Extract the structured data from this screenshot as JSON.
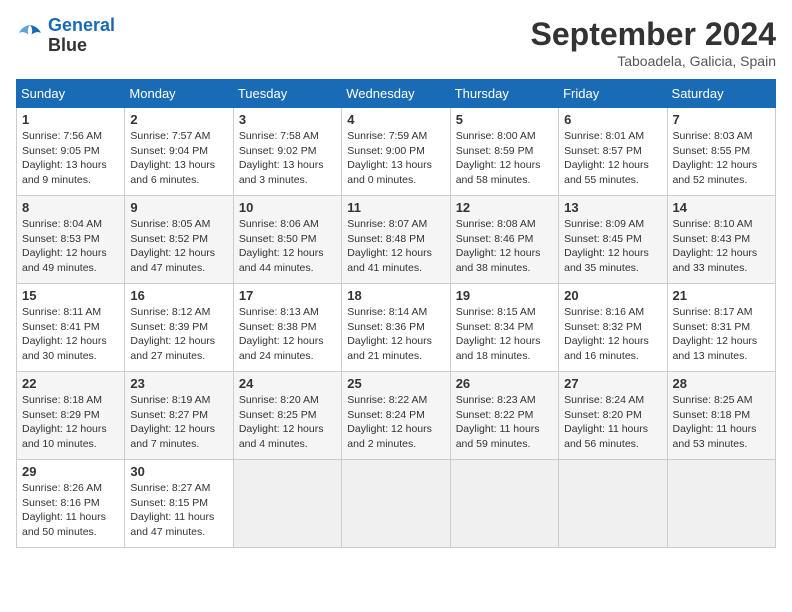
{
  "header": {
    "logo_line1": "General",
    "logo_line2": "Blue",
    "month_year": "September 2024",
    "location": "Taboadela, Galicia, Spain"
  },
  "days_of_week": [
    "Sunday",
    "Monday",
    "Tuesday",
    "Wednesday",
    "Thursday",
    "Friday",
    "Saturday"
  ],
  "weeks": [
    [
      {
        "day": 1,
        "sunrise": "7:56 AM",
        "sunset": "9:05 PM",
        "daylight": "13 hours and 9 minutes."
      },
      {
        "day": 2,
        "sunrise": "7:57 AM",
        "sunset": "9:04 PM",
        "daylight": "13 hours and 6 minutes."
      },
      {
        "day": 3,
        "sunrise": "7:58 AM",
        "sunset": "9:02 PM",
        "daylight": "13 hours and 3 minutes."
      },
      {
        "day": 4,
        "sunrise": "7:59 AM",
        "sunset": "9:00 PM",
        "daylight": "13 hours and 0 minutes."
      },
      {
        "day": 5,
        "sunrise": "8:00 AM",
        "sunset": "8:59 PM",
        "daylight": "12 hours and 58 minutes."
      },
      {
        "day": 6,
        "sunrise": "8:01 AM",
        "sunset": "8:57 PM",
        "daylight": "12 hours and 55 minutes."
      },
      {
        "day": 7,
        "sunrise": "8:03 AM",
        "sunset": "8:55 PM",
        "daylight": "12 hours and 52 minutes."
      }
    ],
    [
      {
        "day": 8,
        "sunrise": "8:04 AM",
        "sunset": "8:53 PM",
        "daylight": "12 hours and 49 minutes."
      },
      {
        "day": 9,
        "sunrise": "8:05 AM",
        "sunset": "8:52 PM",
        "daylight": "12 hours and 47 minutes."
      },
      {
        "day": 10,
        "sunrise": "8:06 AM",
        "sunset": "8:50 PM",
        "daylight": "12 hours and 44 minutes."
      },
      {
        "day": 11,
        "sunrise": "8:07 AM",
        "sunset": "8:48 PM",
        "daylight": "12 hours and 41 minutes."
      },
      {
        "day": 12,
        "sunrise": "8:08 AM",
        "sunset": "8:46 PM",
        "daylight": "12 hours and 38 minutes."
      },
      {
        "day": 13,
        "sunrise": "8:09 AM",
        "sunset": "8:45 PM",
        "daylight": "12 hours and 35 minutes."
      },
      {
        "day": 14,
        "sunrise": "8:10 AM",
        "sunset": "8:43 PM",
        "daylight": "12 hours and 33 minutes."
      }
    ],
    [
      {
        "day": 15,
        "sunrise": "8:11 AM",
        "sunset": "8:41 PM",
        "daylight": "12 hours and 30 minutes."
      },
      {
        "day": 16,
        "sunrise": "8:12 AM",
        "sunset": "8:39 PM",
        "daylight": "12 hours and 27 minutes."
      },
      {
        "day": 17,
        "sunrise": "8:13 AM",
        "sunset": "8:38 PM",
        "daylight": "12 hours and 24 minutes."
      },
      {
        "day": 18,
        "sunrise": "8:14 AM",
        "sunset": "8:36 PM",
        "daylight": "12 hours and 21 minutes."
      },
      {
        "day": 19,
        "sunrise": "8:15 AM",
        "sunset": "8:34 PM",
        "daylight": "12 hours and 18 minutes."
      },
      {
        "day": 20,
        "sunrise": "8:16 AM",
        "sunset": "8:32 PM",
        "daylight": "12 hours and 16 minutes."
      },
      {
        "day": 21,
        "sunrise": "8:17 AM",
        "sunset": "8:31 PM",
        "daylight": "12 hours and 13 minutes."
      }
    ],
    [
      {
        "day": 22,
        "sunrise": "8:18 AM",
        "sunset": "8:29 PM",
        "daylight": "12 hours and 10 minutes."
      },
      {
        "day": 23,
        "sunrise": "8:19 AM",
        "sunset": "8:27 PM",
        "daylight": "12 hours and 7 minutes."
      },
      {
        "day": 24,
        "sunrise": "8:20 AM",
        "sunset": "8:25 PM",
        "daylight": "12 hours and 4 minutes."
      },
      {
        "day": 25,
        "sunrise": "8:22 AM",
        "sunset": "8:24 PM",
        "daylight": "12 hours and 2 minutes."
      },
      {
        "day": 26,
        "sunrise": "8:23 AM",
        "sunset": "8:22 PM",
        "daylight": "11 hours and 59 minutes."
      },
      {
        "day": 27,
        "sunrise": "8:24 AM",
        "sunset": "8:20 PM",
        "daylight": "11 hours and 56 minutes."
      },
      {
        "day": 28,
        "sunrise": "8:25 AM",
        "sunset": "8:18 PM",
        "daylight": "11 hours and 53 minutes."
      }
    ],
    [
      {
        "day": 29,
        "sunrise": "8:26 AM",
        "sunset": "8:16 PM",
        "daylight": "11 hours and 50 minutes."
      },
      {
        "day": 30,
        "sunrise": "8:27 AM",
        "sunset": "8:15 PM",
        "daylight": "11 hours and 47 minutes."
      },
      null,
      null,
      null,
      null,
      null
    ]
  ]
}
